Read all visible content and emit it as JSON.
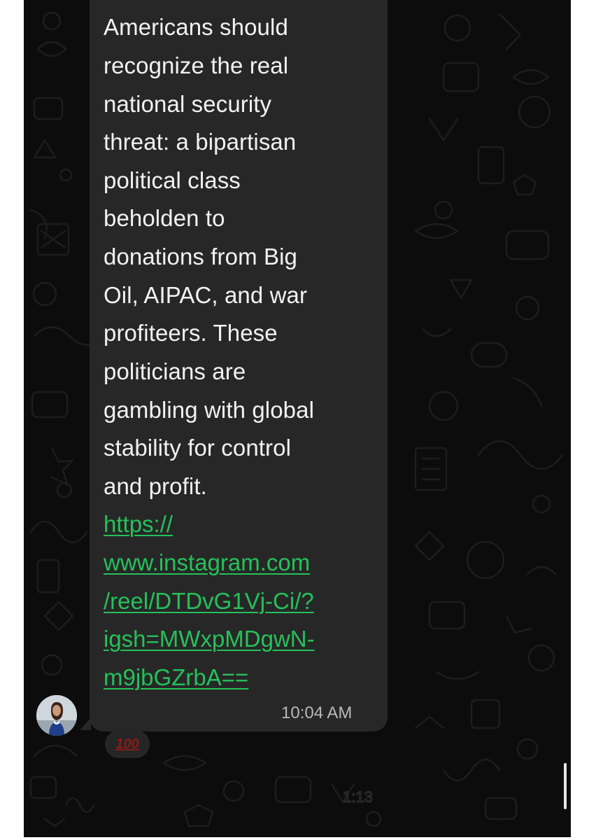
{
  "chat": {
    "message_lines": [
      "Americans should",
      "recognize the real",
      "national security",
      "threat: a bipartisan",
      "political class",
      "beholden to",
      "donations from Big",
      "Oil, AIPAC, and war",
      "profiteers. These",
      "politicians are",
      "gambling with global",
      "stability for control",
      "and profit."
    ],
    "link_lines": [
      "https://",
      "www.instagram.com",
      "/reel/DTDvG1Vj-Ci/?",
      "igsh=MWxpMDgwN-",
      "m9jbGZrbA=="
    ],
    "timestamp": "10:04 AM",
    "reaction": "100"
  },
  "colors": {
    "background": "#0c0c0c",
    "bubble": "#272727",
    "text": "#f2f2f2",
    "link": "#25c15a",
    "timestamp": "#b8b8b8"
  },
  "icons": {
    "avatar": "sender-avatar",
    "reaction": "hundred-points-icon"
  }
}
